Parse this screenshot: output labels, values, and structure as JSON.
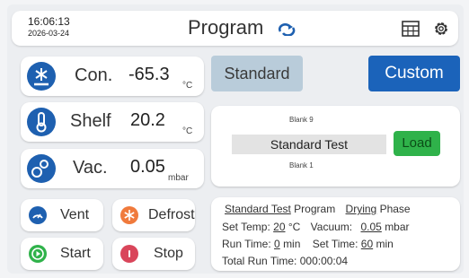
{
  "header": {
    "time": "16:06:13",
    "date": "2026-03-24",
    "title": "Program"
  },
  "sensors": [
    {
      "label": "Con.",
      "value": "-65.3",
      "unit": "°C"
    },
    {
      "label": "Shelf",
      "value": "20.2",
      "unit": "°C"
    },
    {
      "label": "Vac.",
      "value": "0.05",
      "unit": "mbar"
    }
  ],
  "controls": {
    "vent": "Vent",
    "defrost": "Defrost",
    "start": "Start",
    "stop": "Stop"
  },
  "mode": {
    "standard": "Standard",
    "custom": "Custom"
  },
  "program_select": {
    "above": "Blank 9",
    "selected": "Standard Test",
    "below": "Blank 1",
    "load": "Load"
  },
  "info": {
    "program_name": "Standard Test",
    "program_word": "Program",
    "phase_value": "Drying",
    "phase_word": "Phase",
    "set_temp_label": "Set Temp:",
    "set_temp_value": "20",
    "set_temp_unit": "°C",
    "vacuum_label": "Vacuum:",
    "vacuum_value": "0.05",
    "vacuum_unit": "mbar",
    "run_time_label": "Run Time:",
    "run_time_value": "0",
    "run_time_unit": "min",
    "set_time_label": "Set Time:",
    "set_time_value": "60",
    "set_time_unit": "min",
    "total_label": "Total Run Time:",
    "total_value": "000:00:04"
  },
  "colors": {
    "accent": "#1b63ba",
    "load": "#2fb24a",
    "start": "#2fb24a",
    "stop": "#d9455a",
    "defrost": "#f07a3c"
  }
}
